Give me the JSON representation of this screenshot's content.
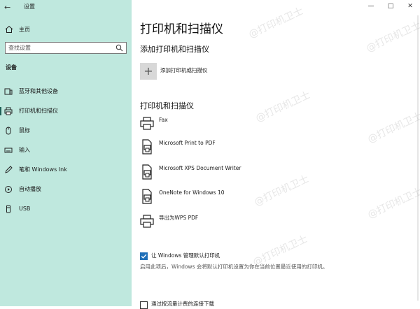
{
  "window": {
    "title": "设置",
    "controls": {
      "minimize": "—",
      "maximize": "□",
      "close": "✕"
    }
  },
  "sidebar": {
    "home_label": "主页",
    "search_placeholder": "查找设置",
    "section_label": "设备",
    "items": [
      {
        "label": "蓝牙和其他设备",
        "icon": "bluetooth-devices-icon"
      },
      {
        "label": "打印机和扫描仪",
        "icon": "printer-icon",
        "active": true
      },
      {
        "label": "鼠标",
        "icon": "mouse-icon"
      },
      {
        "label": "输入",
        "icon": "keyboard-icon"
      },
      {
        "label": "笔和 Windows Ink",
        "icon": "pen-icon"
      },
      {
        "label": "自动播放",
        "icon": "autoplay-icon"
      },
      {
        "label": "USB",
        "icon": "usb-icon"
      }
    ]
  },
  "main": {
    "page_title": "打印机和扫描仪",
    "add_section_title": "添加打印机和扫描仪",
    "add_button_label": "添加打印机或扫描仪",
    "list_section_title": "打印机和扫描仪",
    "printers": [
      {
        "name": "Fax",
        "icon": "fax-printer-icon"
      },
      {
        "name": "Microsoft Print to PDF",
        "icon": "pdf-printer-icon"
      },
      {
        "name": "Microsoft XPS Document Writer",
        "icon": "document-printer-icon"
      },
      {
        "name": "OneNote for Windows 10",
        "icon": "document-printer-icon"
      },
      {
        "name": "导出为WPS PDF",
        "icon": "printer-icon"
      }
    ],
    "manage_default": {
      "label": "让 Windows 管理默认打印机",
      "checked": true,
      "description": "启用此项后，Windows 会将默认打印机设置为你在当前位置最近使用的打印机。"
    },
    "metered": {
      "label": "通过按流量计费的连接下载",
      "checked": false
    }
  },
  "watermark_text": "@打印机卫士",
  "colors": {
    "sidebar_bg": "#bfe8de",
    "accent": "#1f6fb8",
    "active_marker": "#1f5f56"
  }
}
